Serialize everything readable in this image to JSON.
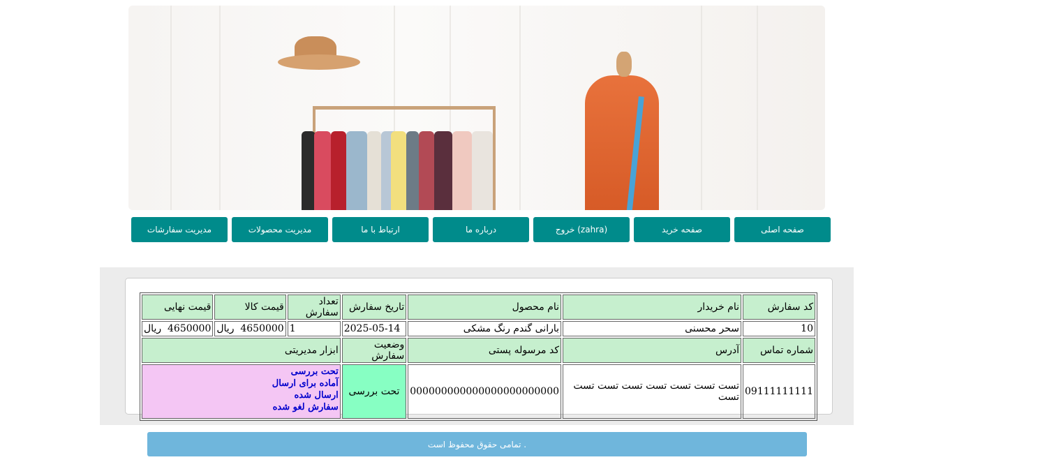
{
  "nav": {
    "items": [
      {
        "label": "صفحه اصلی"
      },
      {
        "label": "صفحه خرید"
      },
      {
        "label": "خروج (zahra)"
      },
      {
        "label": "درباره ما"
      },
      {
        "label": "ارتباط با ما"
      },
      {
        "label": "مدیریت محصولات"
      },
      {
        "label": "مدیریت سفارشات"
      }
    ]
  },
  "orders": {
    "headers1": {
      "order_code": "کد سفارش",
      "buyer_name": "نام خریدار",
      "product_name": "نام محصول",
      "order_date": "تاریخ سفارش",
      "quantity": "تعداد سفارش",
      "unit_price": "قیمت کالا",
      "final_price": "قیمت نهایی"
    },
    "row": {
      "order_code": "10",
      "buyer_name": "سحر محسنی",
      "product_name": "بارانی گندم رنگ مشکی",
      "order_date": "2025-05-14",
      "quantity": "1",
      "unit_price": "4650000  ریال",
      "final_price": "4650000  ریال"
    },
    "headers2": {
      "phone": "شماره تماس",
      "address": "آدرس",
      "postal_code": "کد مرسوله پستی",
      "status": "وضعیت سفارش",
      "tools": "ابزار مدیریتی"
    },
    "details": {
      "phone": "09111111111",
      "address": "تست تست تست تست تست تست تست تست",
      "postal_code": "000000000000000000000000",
      "status": "تحت بررسی"
    },
    "tools": [
      {
        "label": "تحت بررسی"
      },
      {
        "label": "آماده برای ارسال"
      },
      {
        "label": "ارسال شده"
      },
      {
        "label": "سفارش لغو شده"
      }
    ]
  },
  "footer": {
    "text": "تمامی حقوق محفوظ است ."
  },
  "colors": {
    "nav_bg": "#008b8b",
    "header_cell": "#c6efce",
    "status_cell": "#87ffc3",
    "tools_cell": "#f4c6f4",
    "tool_link": "#0000cc",
    "footer_bg": "#6fb6dc"
  },
  "icons": {
    "banner": "clothing-store-banner-image"
  }
}
